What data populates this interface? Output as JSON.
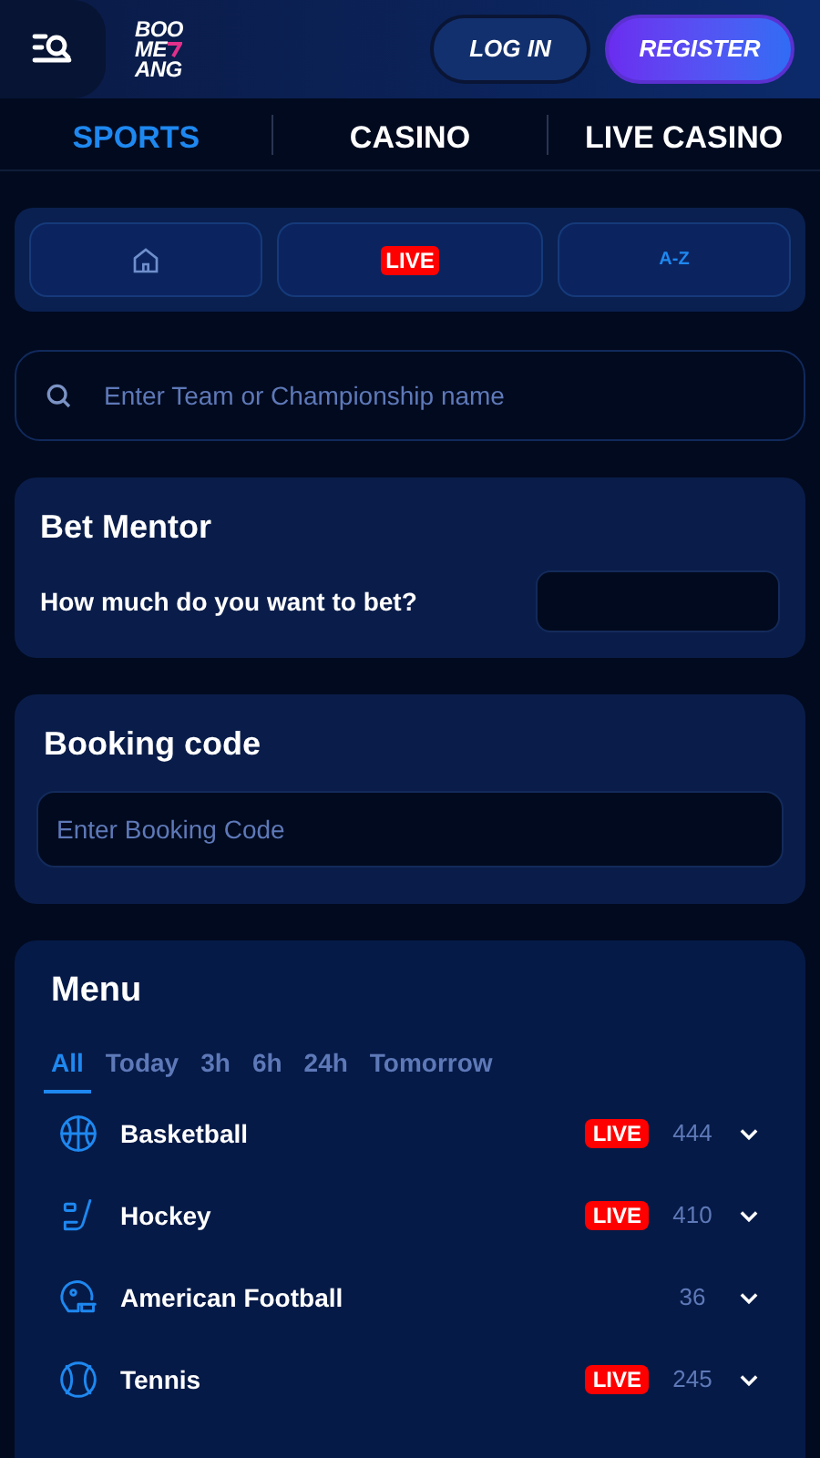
{
  "header": {
    "logo_lines": [
      "BOO",
      "ME",
      "ANG"
    ],
    "login": "LOG IN",
    "register": "REGISTER"
  },
  "nav_tabs": [
    {
      "label": "SPORTS",
      "selected": true
    },
    {
      "label": "CASINO",
      "selected": false
    },
    {
      "label": "LIVE CASINO",
      "selected": false
    }
  ],
  "quick_buttons": [
    {
      "kind": "home"
    },
    {
      "kind": "live",
      "label": "LIVE"
    },
    {
      "kind": "az",
      "label": "A-Z"
    }
  ],
  "search": {
    "placeholder": "Enter Team or Championship name"
  },
  "bet_mentor": {
    "title": "Bet Mentor",
    "question": "How much do you want to bet?"
  },
  "booking": {
    "title": "Booking code",
    "placeholder": "Enter Booking Code"
  },
  "menu": {
    "title": "Menu",
    "filters": [
      {
        "label": "All",
        "selected": true
      },
      {
        "label": "Today",
        "selected": false
      },
      {
        "label": "3h",
        "selected": false
      },
      {
        "label": "6h",
        "selected": false
      },
      {
        "label": "24h",
        "selected": false
      },
      {
        "label": "Tomorrow",
        "selected": false
      }
    ],
    "sports": [
      {
        "kind": "basketball",
        "name": "Basketball",
        "live": "LIVE",
        "count": "444"
      },
      {
        "kind": "hockey",
        "name": "Hockey",
        "live": "LIVE",
        "count": "410"
      },
      {
        "kind": "football",
        "name": "American Football",
        "count": "36"
      },
      {
        "kind": "tennis",
        "name": "Tennis",
        "live": "LIVE",
        "count": "245"
      }
    ]
  }
}
